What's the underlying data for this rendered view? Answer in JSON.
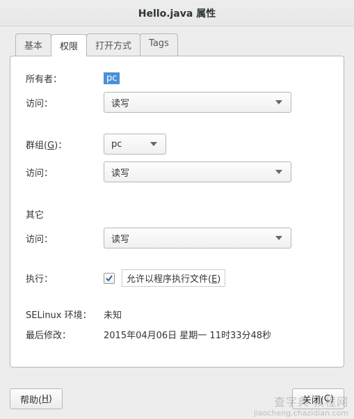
{
  "window": {
    "title": "Hello.java 属性"
  },
  "tabs": {
    "basic": "基本",
    "permissions": "权限",
    "openwith": "打开方式",
    "tags": "Tags"
  },
  "labels": {
    "owner": "所有者：",
    "access": "访问：",
    "group_prefix": "群组(",
    "group_key": "G",
    "group_suffix": ")：",
    "others": "其它",
    "execute": "执行：",
    "selinux": "SELinux 环境：",
    "lastmod": "最后修改："
  },
  "values": {
    "owner": "pc",
    "owner_access": "读写",
    "group": "pc",
    "group_access": "读写",
    "others_access": "读写",
    "execute_prefix": "允许以程序执行文件(",
    "execute_key": "E",
    "execute_suffix": ")",
    "selinux": "未知",
    "lastmod": "2015年04月06日 星期一 11时33分48秒"
  },
  "buttons": {
    "help_prefix": "帮助(",
    "help_key": "H",
    "help_suffix": ")",
    "close_prefix": "关闭(",
    "close_key": "C",
    "close_suffix": ")"
  },
  "watermark": {
    "line1": "查字典   教程网",
    "line2": "jiaocheng.chazidian.com"
  }
}
